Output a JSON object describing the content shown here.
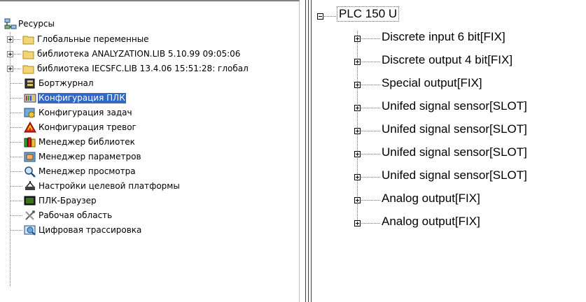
{
  "resources_tree": {
    "root": {
      "label": "Ресурсы",
      "icon": "resources-icon"
    },
    "items": [
      {
        "label": "Глобальные переменные",
        "icon": "folder-icon",
        "expandable": true,
        "selected": false
      },
      {
        "label": "библиотека ANALYZATION.LIB 5.10.99 09:05:06",
        "icon": "folder-icon",
        "expandable": true,
        "selected": false
      },
      {
        "label": "библиотека IECSFC.LIB 13.4.06 15:51:28: глобал",
        "icon": "folder-icon",
        "expandable": true,
        "selected": false
      },
      {
        "label": "Бортжурнал",
        "icon": "log-book-icon",
        "expandable": false,
        "selected": false
      },
      {
        "label": "Конфигурация ПЛК",
        "icon": "plc-config-icon",
        "expandable": false,
        "selected": true
      },
      {
        "label": "Конфигурация задач",
        "icon": "task-config-icon",
        "expandable": false,
        "selected": false
      },
      {
        "label": "Конфигурация тревог",
        "icon": "alarm-config-icon",
        "expandable": false,
        "selected": false
      },
      {
        "label": "Менеджер библиотек",
        "icon": "library-manager-icon",
        "expandable": false,
        "selected": false
      },
      {
        "label": "Менеджер параметров",
        "icon": "parameter-manager-icon",
        "expandable": false,
        "selected": false
      },
      {
        "label": "Менеджер просмотра",
        "icon": "magnifier-icon",
        "expandable": false,
        "selected": false
      },
      {
        "label": "Настройки целевой платформы",
        "icon": "target-settings-icon",
        "expandable": false,
        "selected": false
      },
      {
        "label": "ПЛК-Браузер",
        "icon": "plc-browser-icon",
        "expandable": false,
        "selected": false
      },
      {
        "label": "Рабочая область",
        "icon": "workspace-tools-icon",
        "expandable": false,
        "selected": false
      },
      {
        "label": "Цифровая трассировка",
        "icon": "digital-trace-icon",
        "expandable": false,
        "selected": false
      }
    ]
  },
  "plc_config_tree": {
    "root": {
      "label": "PLC 150 U",
      "expanded": true
    },
    "items": [
      {
        "label": "Discrete input 6 bit[FIX]"
      },
      {
        "label": "Discrete output 4 bit[FIX]"
      },
      {
        "label": "Special output[FIX]"
      },
      {
        "label": "Unifed signal sensor[SLOT]"
      },
      {
        "label": "Unifed signal sensor[SLOT]"
      },
      {
        "label": "Unifed signal sensor[SLOT]"
      },
      {
        "label": "Unifed signal sensor[SLOT]"
      },
      {
        "label": "Analog output[FIX]"
      },
      {
        "label": "Analog output[FIX]"
      }
    ]
  },
  "colors": {
    "selection": "#3168c5",
    "folder": "#f2d675",
    "folder_dark": "#b08a1e"
  }
}
